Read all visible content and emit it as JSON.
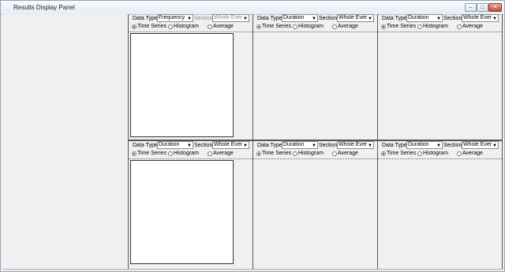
{
  "window": {
    "title": "Results Display Panel",
    "controls": {
      "minimize": "–",
      "maximize": "□",
      "close": "✕"
    }
  },
  "panels": [
    {
      "data_type_label": "Data Type",
      "data_type": "Frequency",
      "section_label": "Section",
      "section": "Whole Ever",
      "section_enabled": false,
      "views": [
        {
          "label": "Time Series",
          "selected": true
        },
        {
          "label": "Histogram",
          "selected": false
        },
        {
          "label": "Average",
          "selected": false
        }
      ],
      "has_plot": true
    },
    {
      "data_type_label": "Data Type",
      "data_type": "Duration",
      "section_label": "Section",
      "section": "Whole Ever",
      "section_enabled": true,
      "views": [
        {
          "label": "Time Series",
          "selected": true
        },
        {
          "label": "Histogram",
          "selected": false
        },
        {
          "label": "Average",
          "selected": false
        }
      ],
      "has_plot": false
    },
    {
      "data_type_label": "Data Type",
      "data_type": "Duration",
      "section_label": "Section",
      "section": "Whole Ever",
      "section_enabled": true,
      "views": [
        {
          "label": "Time Series",
          "selected": true
        },
        {
          "label": "Histogram",
          "selected": false
        },
        {
          "label": "Average",
          "selected": false
        }
      ],
      "has_plot": false
    },
    {
      "data_type_label": "Data Type",
      "data_type": "Duration",
      "section_label": "Section",
      "section": "Whole Ever",
      "section_enabled": true,
      "views": [
        {
          "label": "Time Series",
          "selected": true
        },
        {
          "label": "Histogram",
          "selected": false
        },
        {
          "label": "Average",
          "selected": false
        }
      ],
      "has_plot": true
    },
    {
      "data_type_label": "Data Type",
      "data_type": "Duration",
      "section_label": "Section",
      "section": "Whole Ever",
      "section_enabled": true,
      "views": [
        {
          "label": "Time Series",
          "selected": true
        },
        {
          "label": "Histogram",
          "selected": false
        },
        {
          "label": "Average",
          "selected": false
        }
      ],
      "has_plot": false
    },
    {
      "data_type_label": "Data Type",
      "data_type": "Duration",
      "section_label": "Section",
      "section": "Whole Ever",
      "section_enabled": true,
      "views": [
        {
          "label": "Time Series",
          "selected": true
        },
        {
          "label": "Histogram",
          "selected": false
        },
        {
          "label": "Average",
          "selected": false
        }
      ],
      "has_plot": false
    }
  ]
}
